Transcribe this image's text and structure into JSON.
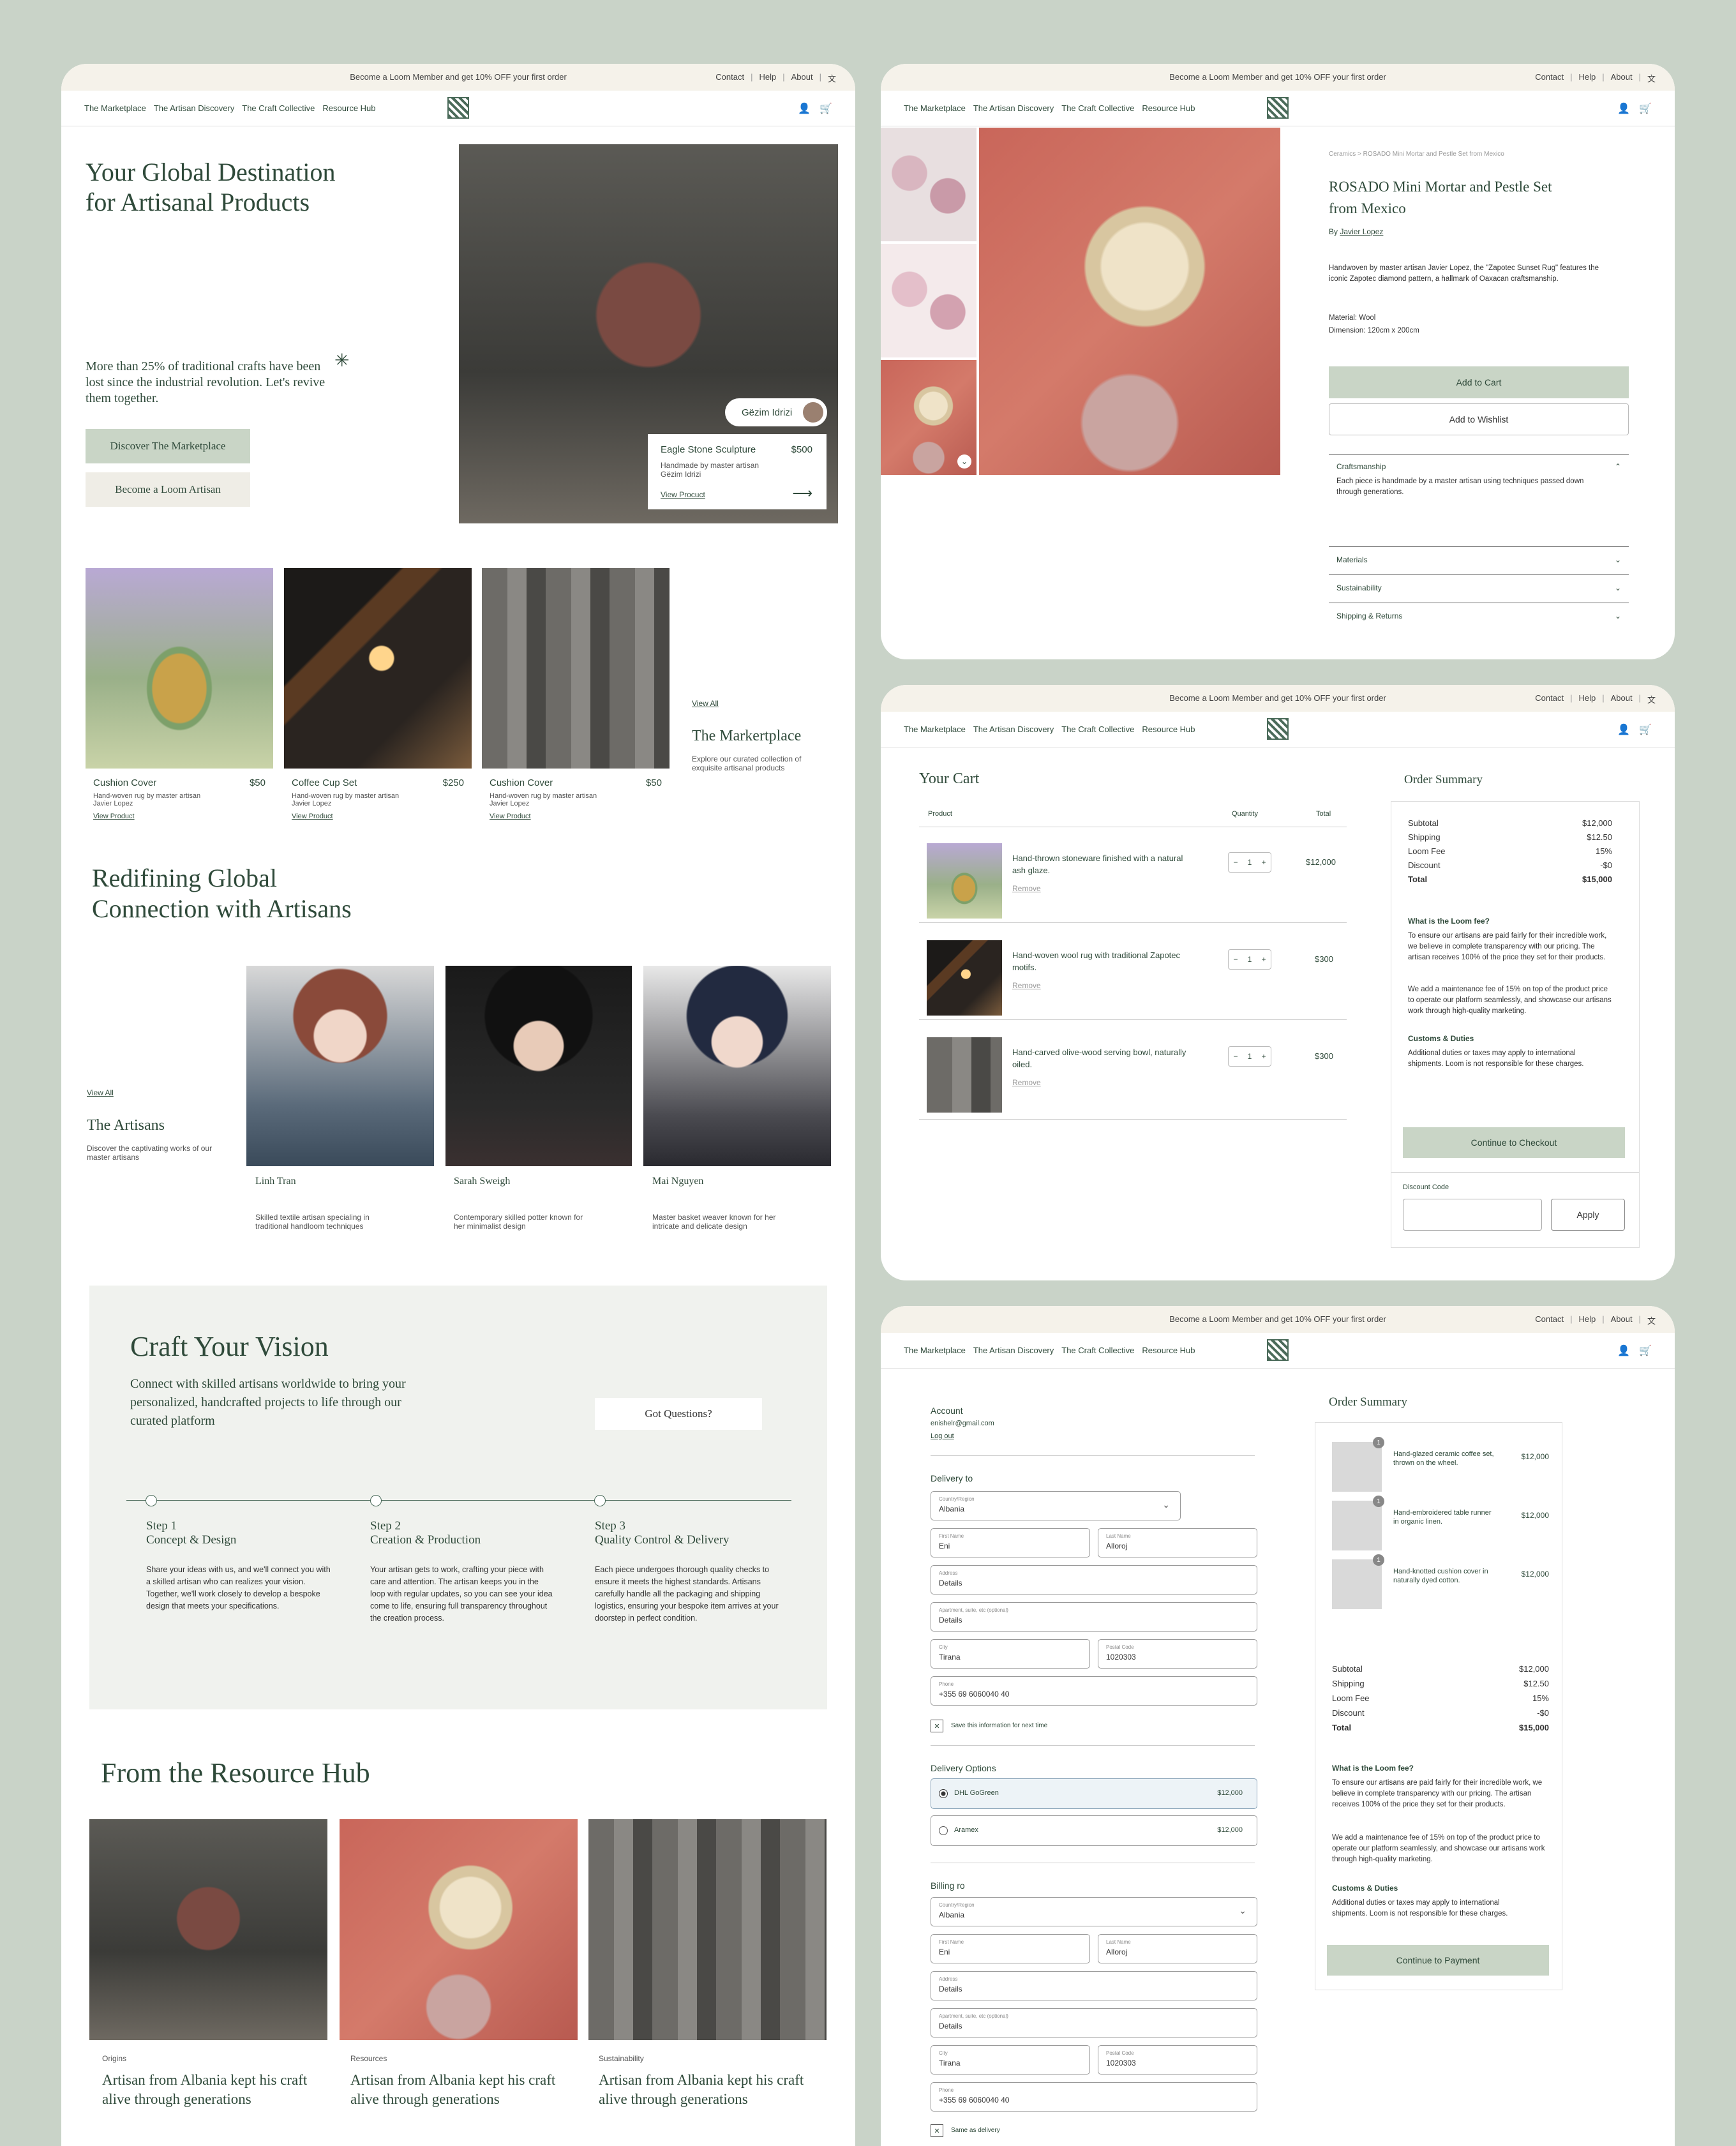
{
  "promo": "Become a Loom Member and get 10% OFF your first order",
  "top_links": [
    "Contact",
    "Help",
    "About"
  ],
  "nav": [
    "The Marketplace",
    "The Artisan Discovery",
    "The Craft Collective",
    "Resource Hub"
  ],
  "home": {
    "hero_title_1": "Your Global Destination",
    "hero_title_2": "for Artisanal Products",
    "hero_text": "More than 25% of traditional crafts have been lost since the industrial revolution. Let's revive them together.",
    "btn_discover": "Discover The Marketplace",
    "btn_artisan": "Become a Loom Artisan",
    "artisan_tag": "Gëzim Idrizi",
    "feature": {
      "name": "Eagle Stone Sculpture",
      "price": "$500",
      "desc": "Handmade by master artisan Gëzim Idrizi",
      "link": "View Procuct"
    },
    "products": [
      {
        "name": "Cushion Cover",
        "price": "$50",
        "desc": "Hand-woven rug by master artisan Javier Lopez",
        "link": "View Product"
      },
      {
        "name": "Coffee Cup Set",
        "price": "$250",
        "desc": "Hand-woven rug by master artisan Javier Lopez",
        "link": "View Product"
      },
      {
        "name": "Cushion Cover",
        "price": "$50",
        "desc": "Hand-woven rug by master artisan Javier Lopez",
        "link": "View Product"
      }
    ],
    "market": {
      "view_all": "View All",
      "title": "The Markertplace",
      "desc": "Explore our curated collection of exquisite artisanal products"
    },
    "redef_1": "Redifining Global",
    "redef_2": "Connection with Artisans",
    "artisans_block": {
      "view_all": "View All",
      "title": "The Artisans",
      "desc": "Discover the captivating works of our master artisans"
    },
    "artisans": [
      {
        "name": "Linh Tran",
        "desc": "Skilled textile artisan specialing in traditional handloom techniques"
      },
      {
        "name": "Sarah Sweigh",
        "desc": "Contemporary skilled potter known for her minimalist design"
      },
      {
        "name": "Mai Nguyen",
        "desc": "Master basket weaver known for her intricate and delicate design"
      }
    ],
    "craft": {
      "title": "Craft Your Vision",
      "text": "Connect with skilled artisans worldwide to bring your personalized, handcrafted projects to life through our curated platform",
      "btn": "Got Questions?"
    },
    "steps": [
      {
        "num": "Step 1",
        "title": "Concept & Design",
        "text": "Share your ideas with us, and we'll connect you with a skilled artisan who can realizes your vision. Together, we'll work closely to develop a bespoke design that meets your specifications."
      },
      {
        "num": "Step 2",
        "title": "Creation & Production",
        "text": "Your artisan gets to work, crafting your piece with care and attention. The artisan keeps you in the loop with regular updates, so you can see your idea come to life, ensuring full transparency throughout the creation process."
      },
      {
        "num": "Step 3",
        "title": "Quality Control & Delivery",
        "text": "Each piece undergoes thorough quality checks to ensure it meets the highest standards. Artisans carefully handle all the packaging and shipping logistics, ensuring your bespoke item arrives at your doorstep in perfect condition."
      }
    ],
    "hub_title": "From the Resource Hub",
    "hub": [
      {
        "tag": "Origins",
        "title": "Artisan from Albania kept his craft alive through generations"
      },
      {
        "tag": "Resources",
        "title": "Artisan from Albania kept his craft alive through generations"
      },
      {
        "tag": "Sustainability",
        "title": "Artisan from Albania kept his craft alive through generations"
      }
    ]
  },
  "product": {
    "crumb": "Ceramics > ROSADO Mini Mortar and Pestle Set from Mexico",
    "title_1": "ROSADO Mini Mortar and Pestle Set",
    "title_2": "from Mexico",
    "by": "By",
    "author": "Javier Lopez",
    "desc": "Handwoven by master artisan Javier Lopez, the \"Zapotec Sunset Rug\" features the iconic Zapotec diamond pattern, a hallmark of Oaxacan craftsmanship.",
    "material": "Material:  Wool",
    "dimension": "Dimension: 120cm x 200cm",
    "add_cart": "Add to Cart",
    "add_wish": "Add to Wishlist",
    "craft_h": "Craftsmanship",
    "craft_t": "Each piece is handmade by a master artisan using techniques passed down through generations.",
    "acc": [
      "Materials",
      "Sustainability",
      "Shipping & Returns"
    ]
  },
  "cart": {
    "title": "Your Cart",
    "cols": [
      "Product",
      "Quantity",
      "Total"
    ],
    "items": [
      {
        "name": "Hand-thrown stoneware finished with a natural ash glaze.",
        "qty": "1",
        "total": "$12,000",
        "remove": "Remove"
      },
      {
        "name": "Hand-woven wool rug with traditional Zapotec motifs.",
        "qty": "1",
        "total": "$300",
        "remove": "Remove"
      },
      {
        "name": "Hand-carved olive-wood serving bowl, naturally oiled.",
        "qty": "1",
        "total": "$300",
        "remove": "Remove"
      }
    ],
    "summary_title": "Order Summary",
    "summary": [
      [
        "Subtotal",
        "$12,000"
      ],
      [
        "Shipping",
        "$12.50"
      ],
      [
        "Loom Fee",
        "15%"
      ],
      [
        "Discount",
        "-$0"
      ],
      [
        "Total",
        "$15,000"
      ]
    ],
    "fee_h": "What is the Loom fee?",
    "fee_t1": "To ensure our artisans are paid fairly for their incredible work, we believe in complete transparency with our pricing. The artisan receives 100% of the price they set for their products.",
    "fee_t2": "We add a maintenance fee of 15% on top of the product price to operate our platform seamlessly, and showcase our artisans work through high-quality marketing.",
    "duty_h": "Customs & Duties",
    "duty_t": "Additional duties or taxes may apply to international shipments. Loom is not responsible for these charges.",
    "checkout": "Continue to Checkout",
    "disc_label": "Discount Code",
    "apply": "Apply"
  },
  "checkout": {
    "account_h": "Account",
    "email": "enishelr@gmail.com",
    "logout": "Log out",
    "delivery_h": "Delivery to",
    "country_l": "Country/Region",
    "country_v": "Albania",
    "first_l": "First Name",
    "first_v": "Eni",
    "last_l": "Last Name",
    "last_v": "Alloroj",
    "addr_l": "Address",
    "addr_v": "Details",
    "apt_l": "Apartment, suite, etc (optional)",
    "apt_v": "Details",
    "city_l": "City",
    "city_v": "Tirana",
    "postal_l": "Postal Code",
    "postal_v": "1020303",
    "phone_l": "Phone",
    "phone_v": "+355 69 6060040 40",
    "save": "Save this information for next time",
    "opt_h": "Delivery Options",
    "opts": [
      {
        "name": "DHL GoGreen",
        "price": "$12,000"
      },
      {
        "name": "Aramex",
        "price": "$12,000"
      }
    ],
    "billing_h": "Billing ro",
    "same": "Same as delivery",
    "summary_title": "Order Summary",
    "items": [
      {
        "badge": "1",
        "name": "Hand-glazed ceramic coffee set, thrown on the wheel.",
        "price": "$12,000"
      },
      {
        "badge": "1",
        "name": "Hand-embroidered table runner in organic linen.",
        "price": "$12,000"
      },
      {
        "badge": "1",
        "name": "Hand-knotted cushion cover in naturally dyed cotton.",
        "price": "$12,000"
      }
    ],
    "pay": "Continue to Payment"
  }
}
